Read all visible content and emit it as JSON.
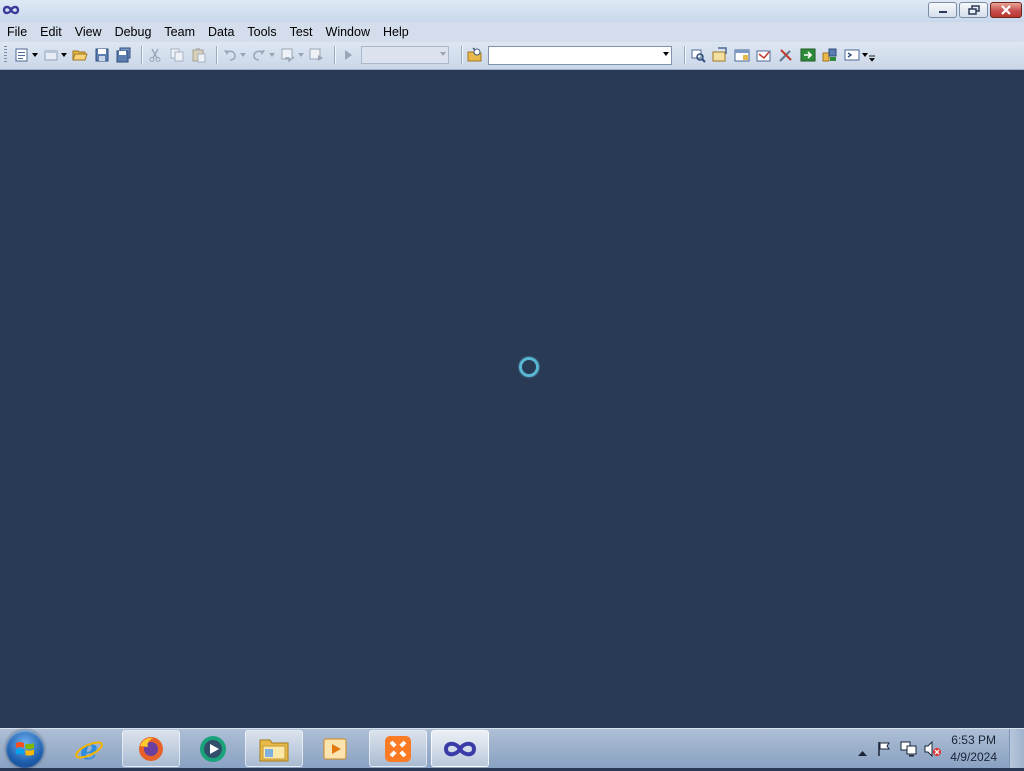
{
  "menu": [
    "File",
    "Edit",
    "View",
    "Debug",
    "Team",
    "Data",
    "Tools",
    "Test",
    "Window",
    "Help"
  ],
  "toolbar": {
    "config_combo_value": "",
    "find_combo_value": ""
  },
  "status": {
    "loading": true
  },
  "taskbar": {
    "apps": [
      "internet-explorer",
      "firefox",
      "media-player",
      "file-explorer",
      "media-center",
      "xampp",
      "visual-studio"
    ],
    "clock_time": "6:53 PM",
    "clock_date": "4/9/2024"
  },
  "colors": {
    "workspace": "#293a55",
    "spinner": "#58b7d3"
  }
}
